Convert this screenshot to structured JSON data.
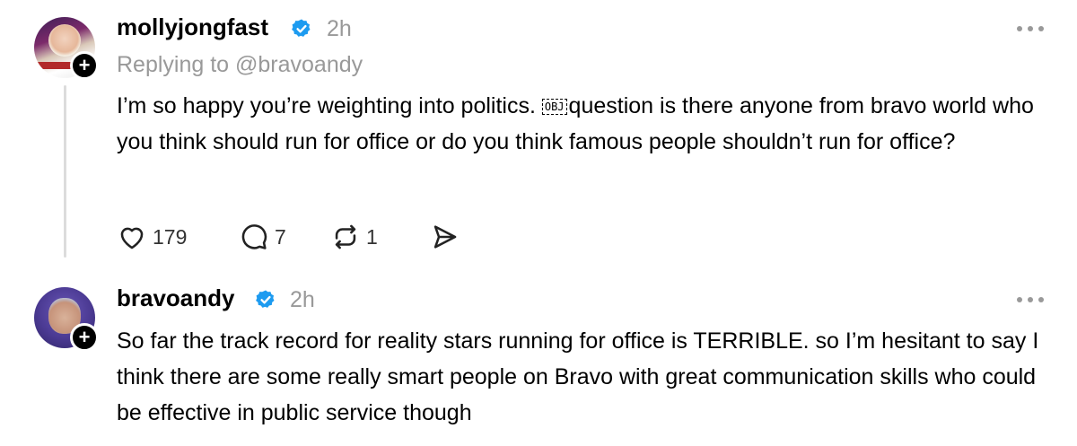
{
  "thread": {
    "post": {
      "username": "mollyjongfast",
      "time": "2h",
      "replying_to": "Replying to @bravoandy",
      "text_before_obj": "I’m so happy you’re weighting into politics. ",
      "obj_glyph": "OBJ",
      "text_after_obj": "question is there anyone from bravo world who you think should run for office or do you think famous people shouldn’t run for office?",
      "likes": "179",
      "replies": "7",
      "reposts": "1",
      "icons": {
        "like": "heart-icon",
        "reply": "comment-icon",
        "repost": "repost-icon",
        "share": "send-icon",
        "verified": "verified-badge-icon",
        "more": "more-icon",
        "follow": "plus-icon"
      }
    },
    "reply": {
      "username": "bravoandy",
      "time": "2h",
      "text": "So far the track record for reality stars running for office is TERRIBLE. so I’m hesitant to say I think there are some really smart people on Bravo with great communication skills who could be effective in public service though"
    }
  },
  "colors": {
    "verified": "#1d9bf0",
    "muted": "#999999",
    "text": "#000000"
  }
}
